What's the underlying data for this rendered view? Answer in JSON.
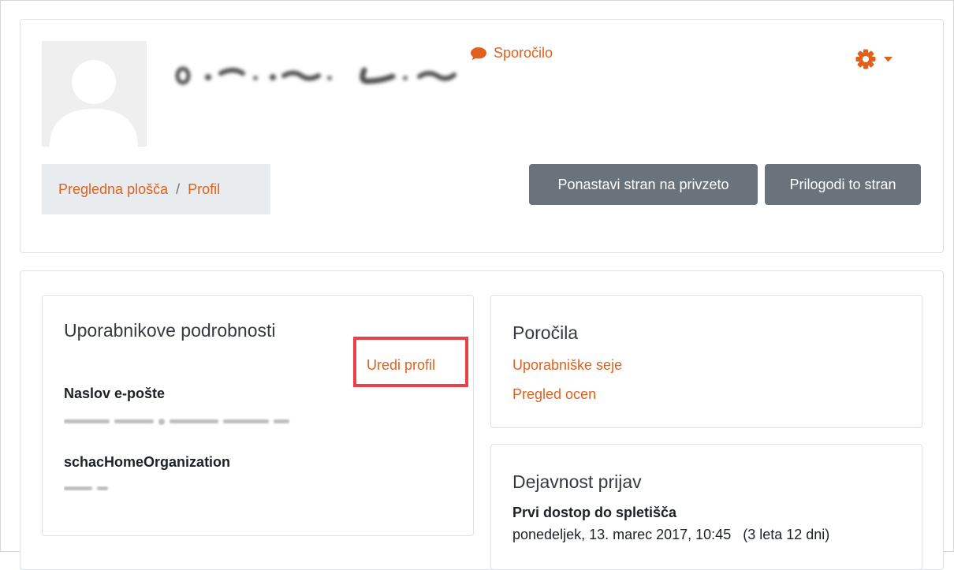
{
  "header": {
    "message_label": "Sporočilo",
    "icons": {
      "message": "speech-bubble-icon",
      "settings": "gear-icon",
      "caret": "caret-down-icon",
      "avatar": "default-user-avatar"
    },
    "breadcrumb": [
      {
        "label": "Pregledna plošča"
      },
      {
        "label": "Profil"
      }
    ],
    "breadcrumb_separator": "/",
    "buttons": {
      "reset_label": "Ponastavi stran na privzeto",
      "customize_label": "Prilogodi to stran"
    }
  },
  "user_details": {
    "title": "Uporabnikove podrobnosti",
    "edit_profile_label": "Uredi profil",
    "fields": [
      {
        "label": "Naslov e-pošte"
      },
      {
        "label": "schacHomeOrganization"
      }
    ]
  },
  "reports": {
    "title": "Poročila",
    "links": [
      "Uporabniške seje",
      "Pregled ocen"
    ]
  },
  "login_activity": {
    "title": "Dejavnost prijav",
    "first_access_label": "Prvi dostop do spletišča",
    "first_access_date": "ponedeljek, 13. marec 2017, 10:45",
    "first_access_ago": "(3 leta 12 dni)"
  },
  "colors": {
    "accent": "#e0611d",
    "button": "#6a737b",
    "highlight": "#ec3f4c",
    "breadcrumb_bg": "#e9ecef",
    "border": "#dee2e6"
  }
}
